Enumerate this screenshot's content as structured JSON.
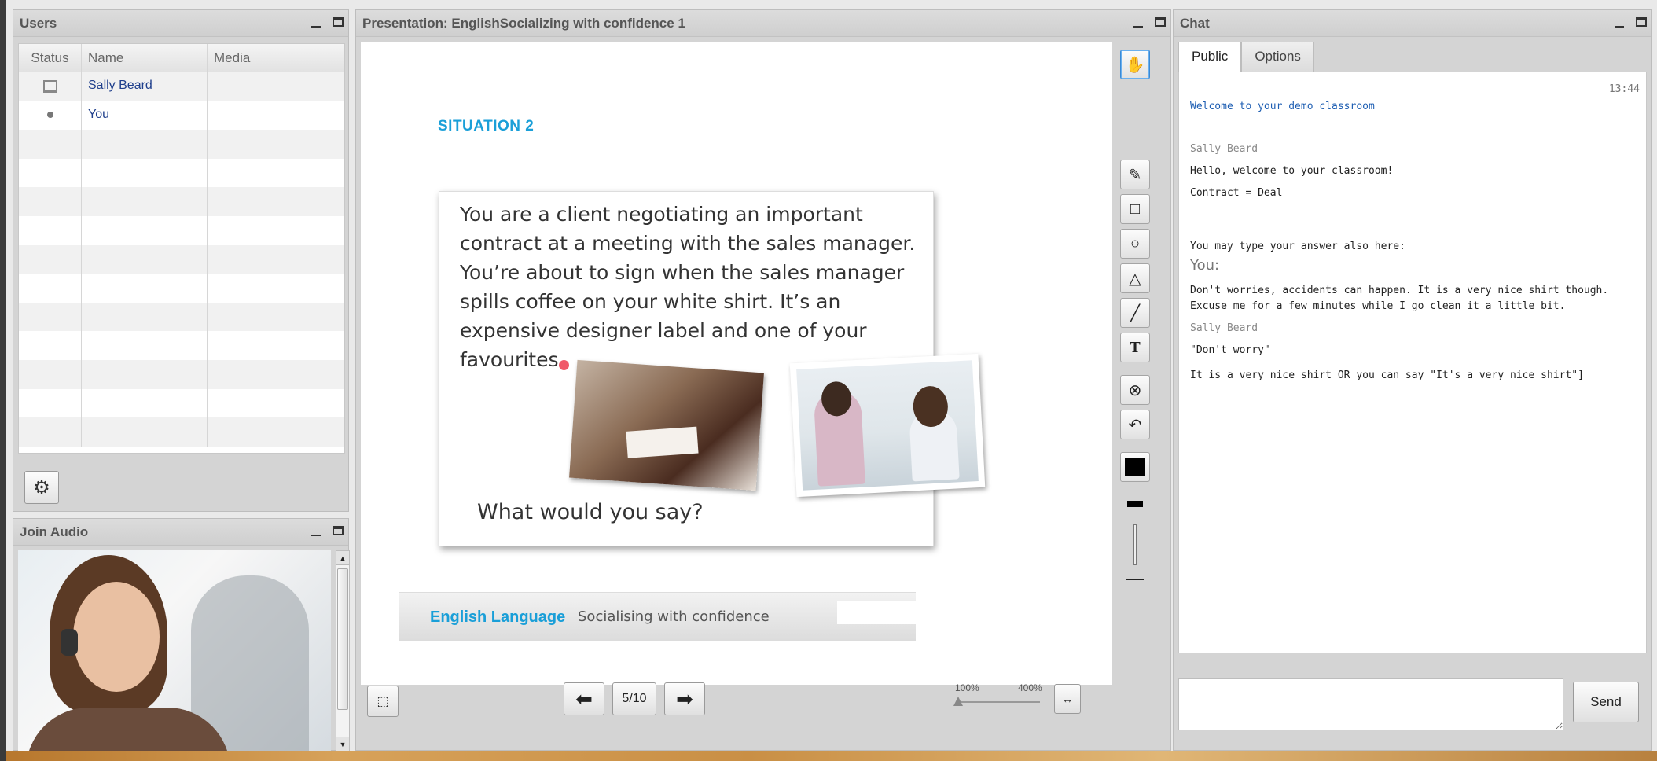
{
  "users_panel": {
    "title": "Users",
    "columns": [
      "Status",
      "Name",
      "Media"
    ],
    "rows": [
      {
        "status_icon": "presenter-icon",
        "name": "Sally Beard",
        "media": ""
      },
      {
        "status_icon": "dot-icon",
        "name": "You",
        "media": ""
      }
    ],
    "empty_rows": 11,
    "settings_icon": "gear-icon"
  },
  "audio_panel": {
    "title": "Join Audio"
  },
  "presentation": {
    "title": "Presentation: EnglishSocializing with confidence 1",
    "slide": {
      "heading": "SITUATION 2",
      "body": "You are a client negotiating an important contract at a meeting with the sales manager. You’re about to sign when the sales manager spills coffee on your  white shirt. It’s an expensive designer label and one of your favourites.",
      "question": "What would you say?",
      "footer_brand": "English Language",
      "footer_topic": "Socialising with confidence"
    },
    "page_indicator": "5/10",
    "zoom_min": "100%",
    "zoom_max": "400%",
    "zoom_level": 0.0,
    "accent_color": "#1a9fd8"
  },
  "tools": [
    "hand-icon",
    "pencil-icon",
    "rectangle-icon",
    "circle-icon",
    "triangle-icon",
    "line-icon",
    "text-icon",
    "clear-icon",
    "undo-icon",
    "color-icon",
    "thickness-icon",
    "thickness-slider-icon",
    "minus-icon"
  ],
  "tool_labels": {
    "text": "T"
  },
  "chat": {
    "title": "Chat",
    "tabs": [
      "Public",
      "Options"
    ],
    "time": "13:44",
    "welcome": "Welcome to your demo classroom",
    "messages": [
      {
        "speaker": "Sally Beard",
        "lines": [
          "Hello, welcome to your classroom!",
          "Contract = Deal",
          "You may type your answer also here:"
        ]
      },
      {
        "speaker": "You:",
        "lines": [
          "Don't worries, accidents can happen. It is a very nice shirt though. Excuse me for a few minutes while I go clean it a little bit."
        ]
      },
      {
        "speaker": "Sally Beard",
        "lines": [
          "\"Don't worry\"",
          "It is a very nice shirt OR you can say \"It's a very nice shirt\"]"
        ]
      }
    ],
    "input_value": "",
    "send_label": "Send"
  }
}
